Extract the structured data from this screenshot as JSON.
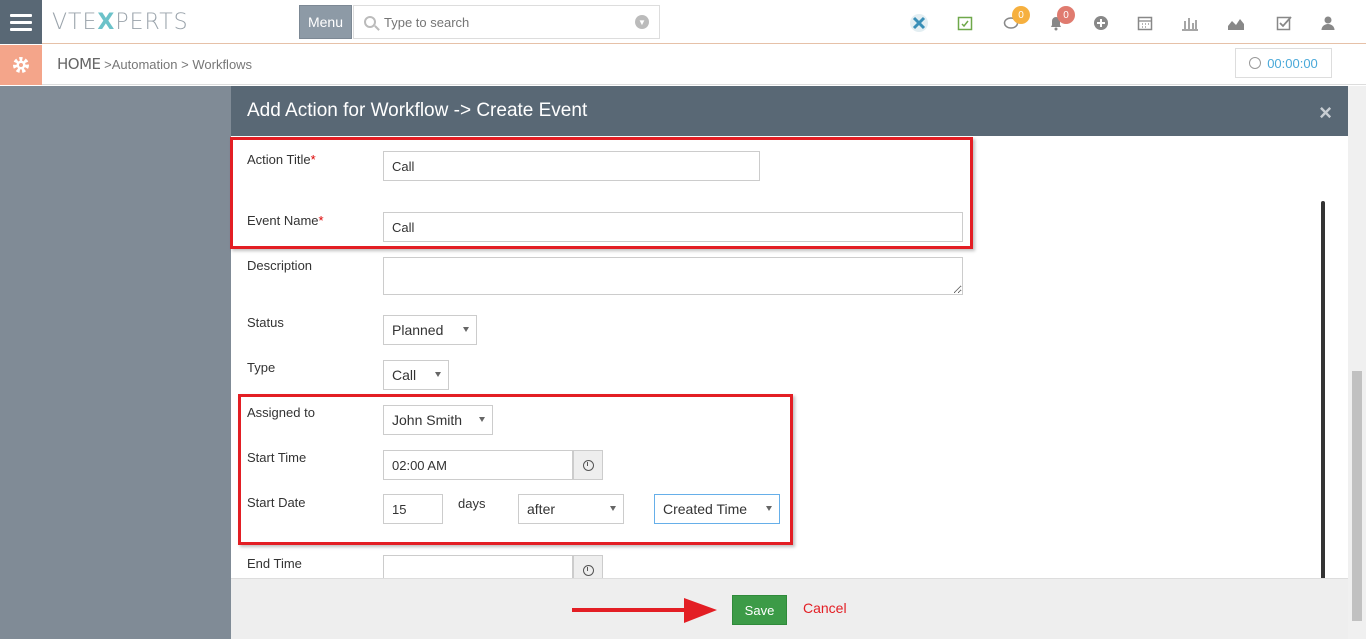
{
  "header": {
    "logo_left": "VTE",
    "logo_x": "X",
    "logo_right": "PERTS",
    "menu_label": "Menu",
    "search_placeholder": "Type to search",
    "chat_badge": "0",
    "notification_badge": "0"
  },
  "subheader": {
    "home": "HOME",
    "crumb_sep1": ">",
    "crumb_1": "Automation",
    "crumb_sep2": ">",
    "crumb_2": "Workflows",
    "timer": "00:00:00"
  },
  "modal": {
    "title": "Add Action for Workflow -> Create Event",
    "close_icon": "×",
    "fields": {
      "action_title_label": "Action Title",
      "action_title_value": "Call",
      "event_name_label": "Event Name",
      "event_name_value": "Call",
      "required_mark": "*",
      "description_label": "Description",
      "description_value": "",
      "status_label": "Status",
      "status_value": "Planned",
      "type_label": "Type",
      "type_value": "Call",
      "assigned_label": "Assigned to",
      "assigned_value": "John Smith",
      "start_time_label": "Start Time",
      "start_time_value": "02:00 AM",
      "start_date_label": "Start Date",
      "start_date_days": "15",
      "days_label": "days",
      "start_date_relation": "after",
      "start_date_reference": "Created Time",
      "end_time_label": "End Time",
      "end_time_value": ""
    }
  },
  "footer": {
    "save_label": "Save",
    "cancel_label": "Cancel"
  },
  "colors": {
    "header_bg": "#596875",
    "highlight": "#e31e24",
    "save_bg": "#3c9b47",
    "accent_orange": "#f4a58a"
  }
}
